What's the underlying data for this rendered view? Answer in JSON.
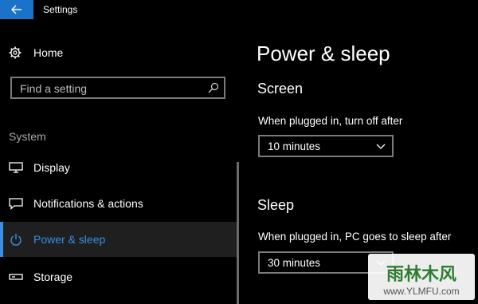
{
  "window": {
    "title": "Settings",
    "accent_color": "#1a73c8"
  },
  "sidebar": {
    "home_label": "Home",
    "search": {
      "placeholder": "Find a setting",
      "value": ""
    },
    "section_label": "System",
    "items": [
      {
        "label": "Display",
        "icon": "monitor-icon",
        "active": false
      },
      {
        "label": "Notifications & actions",
        "icon": "notifications-icon",
        "active": false
      },
      {
        "label": "Power & sleep",
        "icon": "power-icon",
        "active": true
      },
      {
        "label": "Storage",
        "icon": "storage-icon",
        "active": false
      }
    ]
  },
  "main": {
    "title": "Power & sleep",
    "screen": {
      "heading": "Screen",
      "label": "When plugged in, turn off after",
      "value": "10 minutes"
    },
    "sleep": {
      "heading": "Sleep",
      "label": "When plugged in, PC goes to sleep after",
      "value": "30 minutes"
    }
  },
  "watermark": {
    "line1": "雨林木风",
    "line2": "www.YLMFU.com"
  }
}
